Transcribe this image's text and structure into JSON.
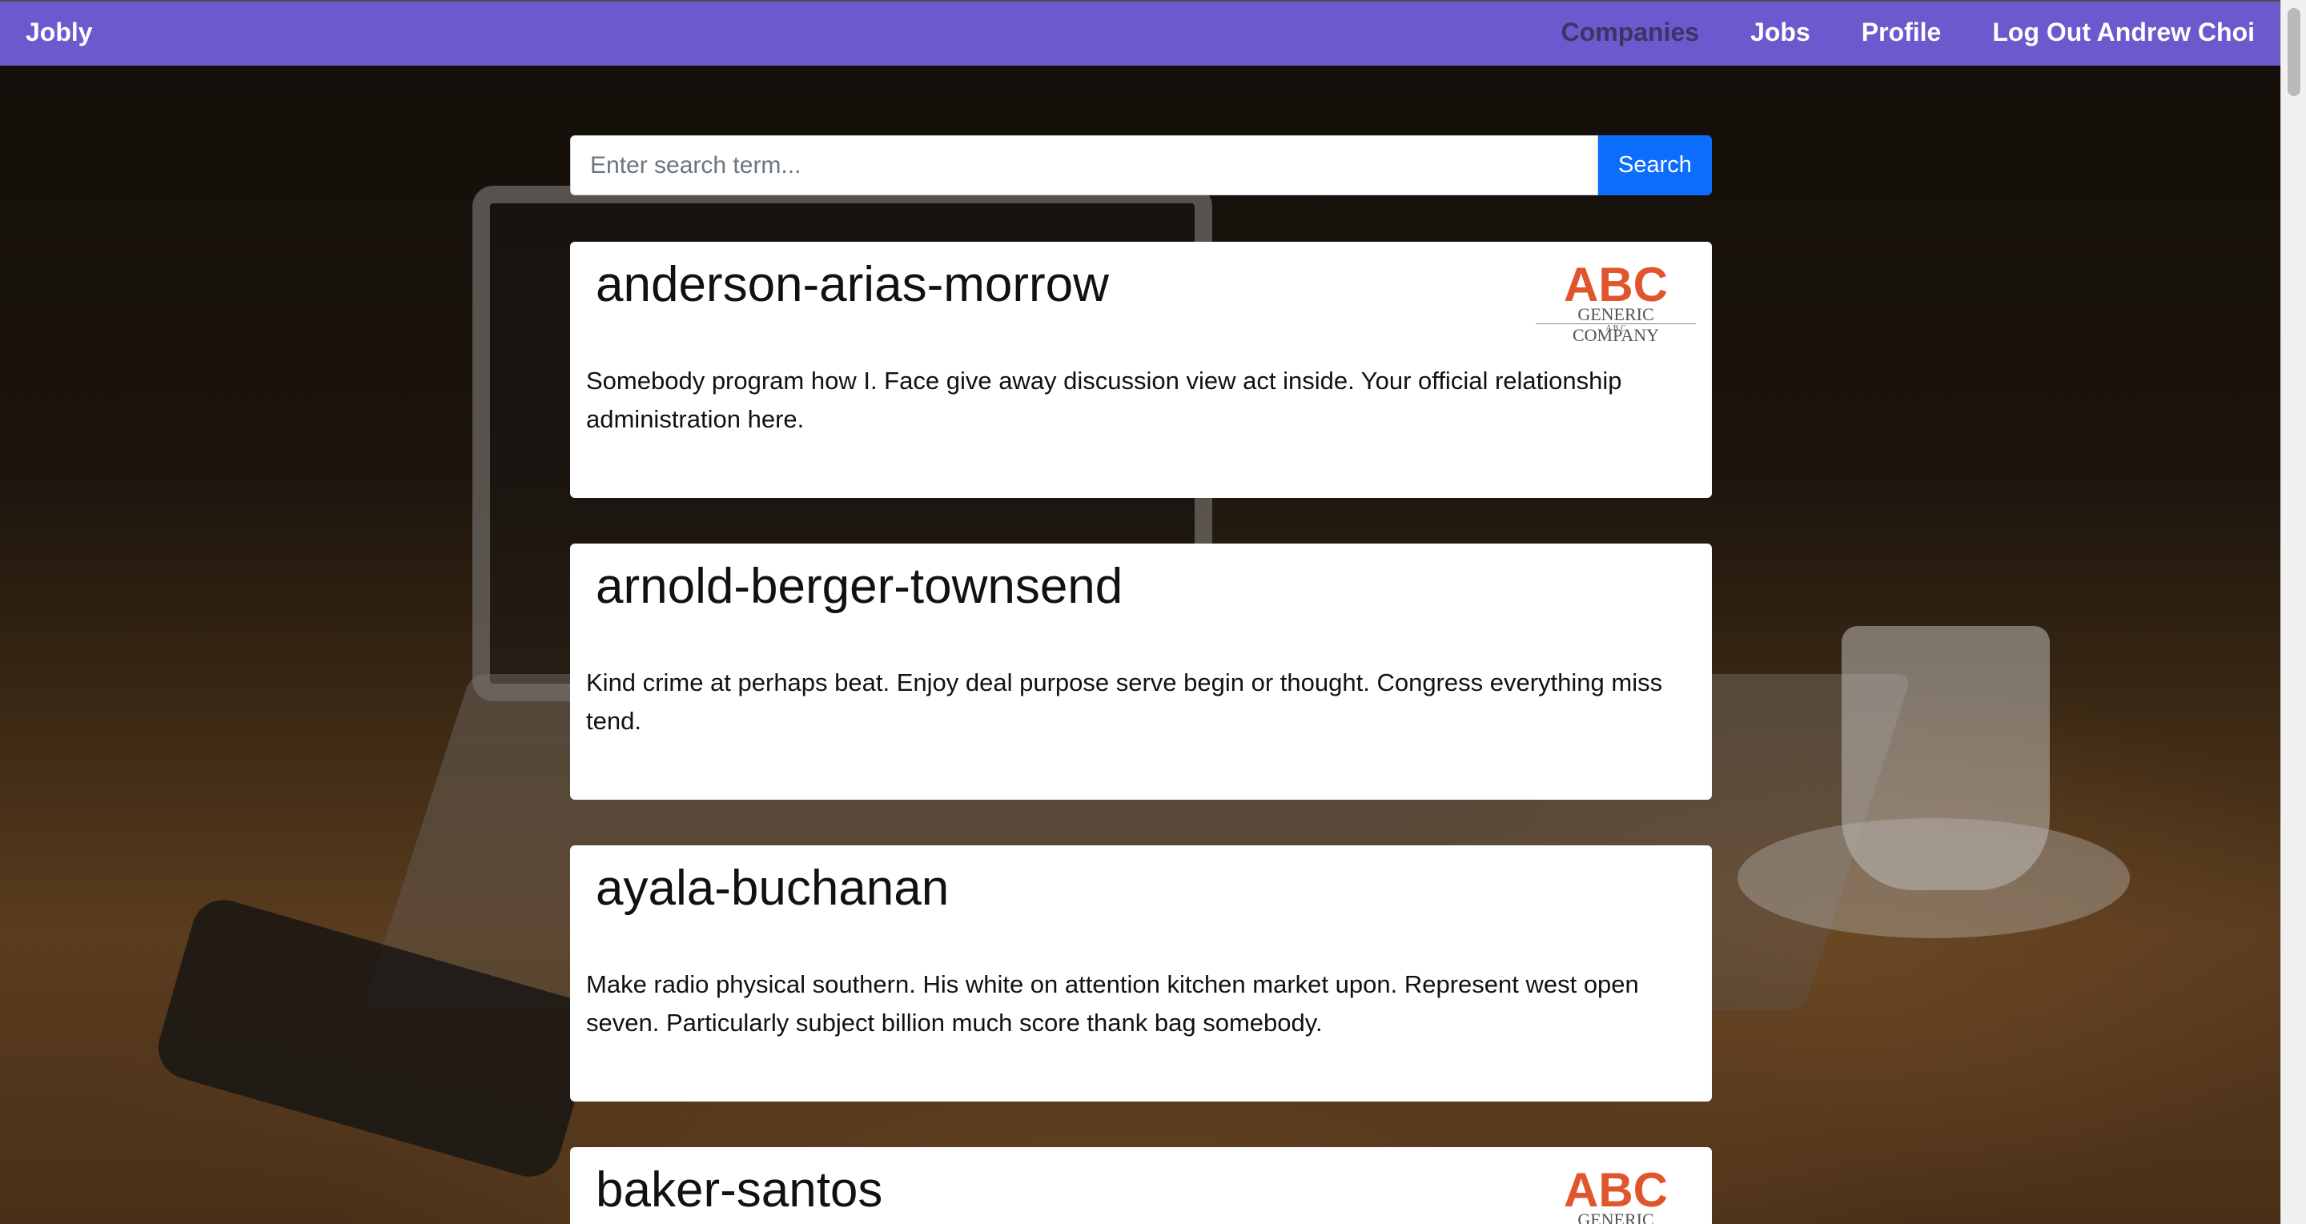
{
  "navbar": {
    "brand": "Jobly",
    "links": [
      {
        "label": "Companies",
        "active": true
      },
      {
        "label": "Jobs",
        "active": false
      },
      {
        "label": "Profile",
        "active": false
      },
      {
        "label": "Log Out Andrew Choi",
        "active": false
      }
    ]
  },
  "search": {
    "placeholder": "Enter search term...",
    "value": "",
    "button_label": "Search"
  },
  "logo": {
    "letters": "ABC",
    "name": "GENERIC COMPANY",
    "tagline": "A B C",
    "colors": {
      "orange": "#e0552b",
      "gray": "#555555"
    }
  },
  "companies": [
    {
      "handle": "anderson-arias-morrow",
      "description": "Somebody program how I. Face give away discussion view act inside. Your official relationship administration here.",
      "has_logo": true
    },
    {
      "handle": "arnold-berger-townsend",
      "description": "Kind crime at perhaps beat. Enjoy deal purpose serve begin or thought. Congress everything miss tend.",
      "has_logo": false
    },
    {
      "handle": "ayala-buchanan",
      "description": "Make radio physical southern. His white on attention kitchen market upon. Represent west open seven. Particularly subject billion much score thank bag somebody.",
      "has_logo": false
    },
    {
      "handle": "baker-santos",
      "description": "",
      "has_logo": true
    }
  ],
  "colors": {
    "navbar": "#6a5acd",
    "nav_active": "#3b3566",
    "search_button": "#0d6efd"
  }
}
